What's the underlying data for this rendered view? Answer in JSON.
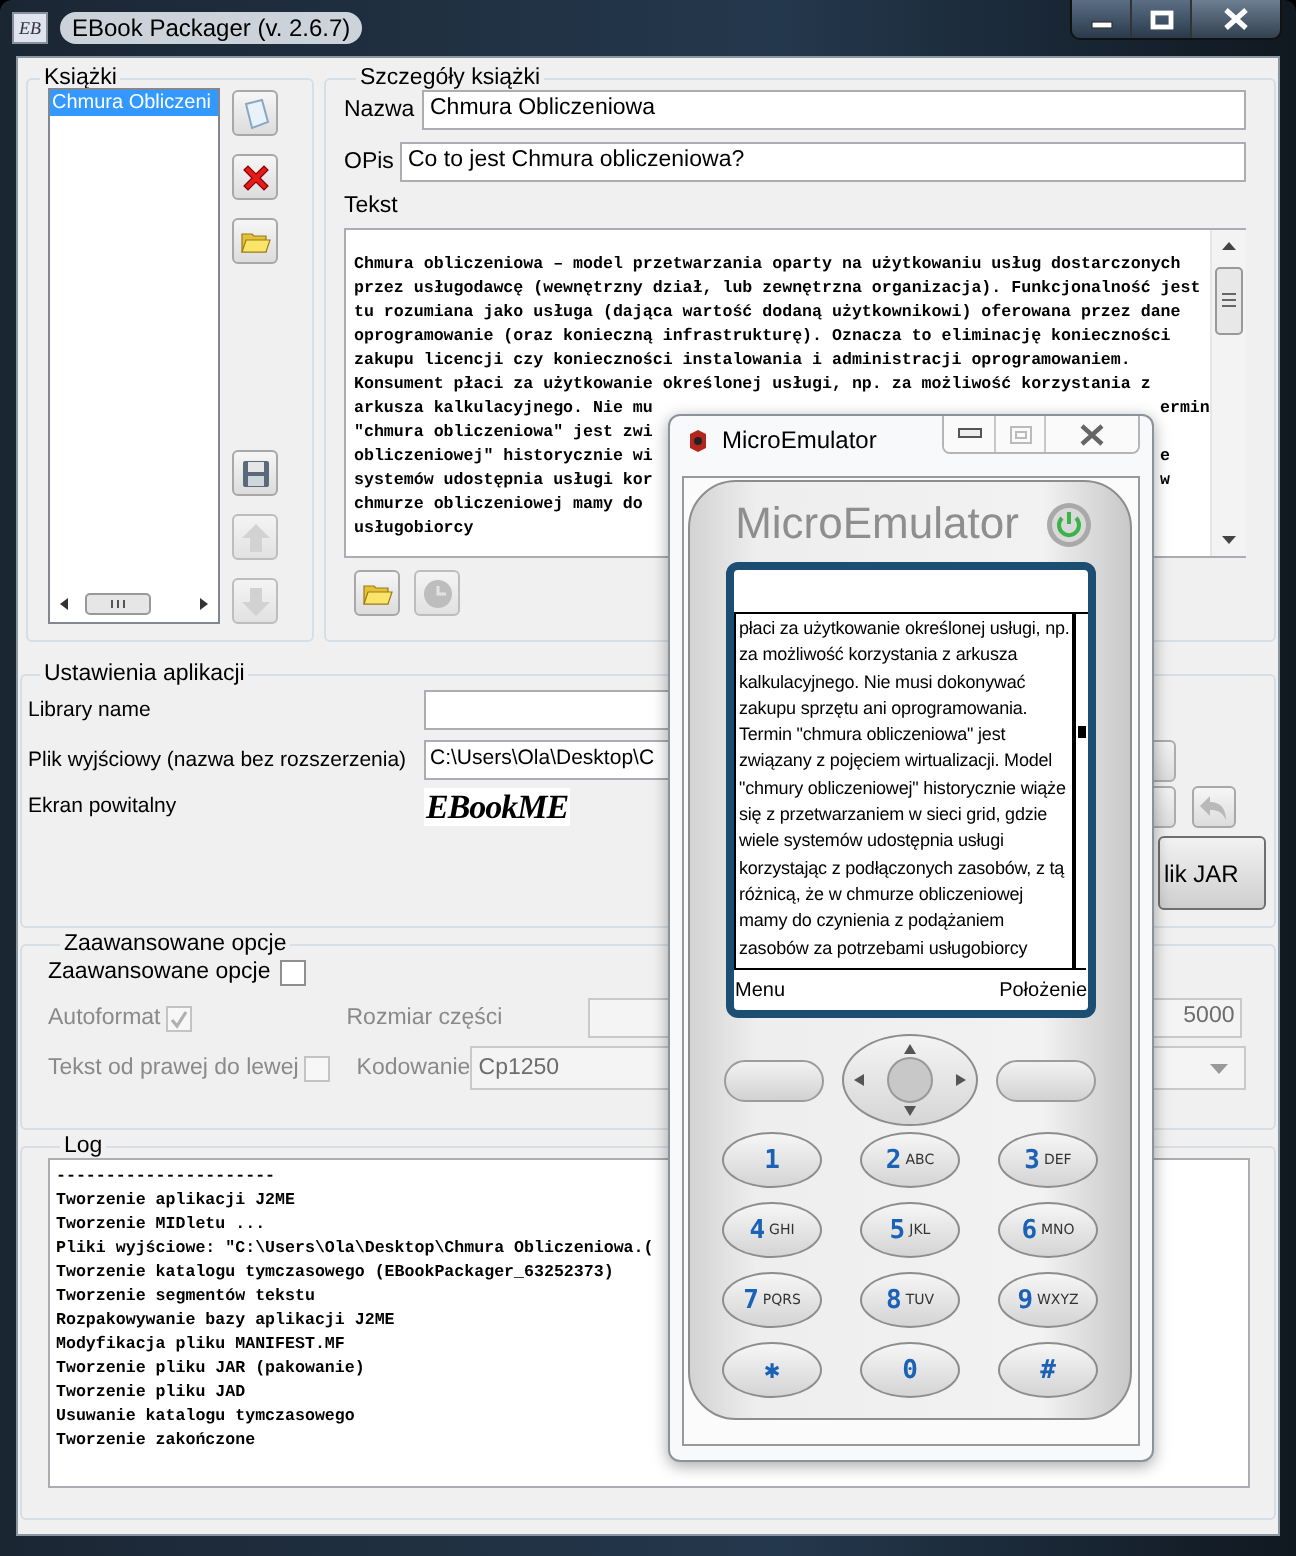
{
  "window": {
    "icon_text": "EB",
    "title": "EBook Packager (v. 2.6.7)"
  },
  "books": {
    "title": "Książki",
    "items": [
      {
        "title": "Chmura Obliczeni",
        "selected": true
      }
    ],
    "buttons": [
      {
        "kind": "new",
        "disabled": false
      },
      {
        "kind": "delete",
        "disabled": false
      },
      {
        "kind": "open",
        "disabled": false
      },
      {
        "kind": "save",
        "disabled": false
      },
      {
        "kind": "up",
        "disabled": true
      },
      {
        "kind": "down",
        "disabled": true
      }
    ]
  },
  "details": {
    "title": "Szczegóły książki",
    "name_label": "Nazwa",
    "name": "Chmura Obliczeniowa",
    "desc_label": "OPis",
    "desc": "Co to jest Chmura obliczeniowa?",
    "text_label": "Tekst",
    "text_lines": [
      {
        "text": "Chmura obliczeniowa – model przetwarzania oparty na użytkowaniu usług dostarczonych"
      },
      {
        "text": "przez usługodawcę (wewnętrzny dział, lub zewnętrzna organizacja). Funkcjonalność jest"
      },
      {
        "text": "tu rozumiana jako usługa (dająca wartość dodaną użytkownikowi) oferowana przez dane"
      },
      {
        "text": "oprogramowanie (oraz konieczną infrastrukturę). Oznacza to eliminację konieczności"
      },
      {
        "text": "zakupu licencji czy konieczności instalowania i administracji oprogramowaniem."
      },
      {
        "text": "Konsument płaci za użytkowanie określonej usługi, np. za możliwość korzystania z"
      },
      {
        "text": "arkusza kalkulacyjnego. Nie mu",
        "right": "ermin"
      },
      {
        "text": "\"chmura obliczeniowa\" jest zwi"
      },
      {
        "text": "obliczeniowej\" historycznie wi",
        "right": "e"
      },
      {
        "text": "systemów udostępnia usługi kor",
        "right": "w"
      },
      {
        "text": "chmurze obliczeniowej mamy do"
      },
      {
        "text": "usługobiorcy"
      }
    ],
    "buttons": [
      {
        "kind": "open",
        "disabled": false
      },
      {
        "kind": "clock",
        "disabled": true
      }
    ]
  },
  "app_settings": {
    "title": "Ustawienia aplikacji",
    "library_label": "Library name",
    "output_label": "Plik wyjściowy (nazwa bez rozszerzenia)",
    "output_value": "C:\\Users\\Ola\\Desktop\\C",
    "splash_label": "Ekran powitalny",
    "splash_text": "EBookME",
    "build_button": "lik JAR"
  },
  "advanced": {
    "title": "Zaawansowane opcje",
    "toggle": {
      "label": "Zaawansowane opcje",
      "checked": false
    },
    "autoformat": {
      "label": "Autoformat",
      "checked": true,
      "disabled": true
    },
    "rtl": {
      "label": "Tekst od prawej do lewej",
      "checked": false,
      "disabled": true
    },
    "part_size": {
      "label": "Rozmiar części",
      "value": "5000",
      "disabled": true
    },
    "encoding": {
      "label": "Kodowanie",
      "value": "Cp1250",
      "disabled": true
    }
  },
  "log": {
    "title": "Log",
    "lines": [
      "----------------------",
      "Tworzenie aplikacji J2ME",
      "Tworzenie MIDletu ...",
      "Pliki wyjściowe: \"C:\\Users\\Ola\\Desktop\\Chmura Obliczeniowa.(",
      "Tworzenie katalogu tymczasowego (EBookPackager_63252373)",
      "Tworzenie segmentów tekstu",
      "Rozpakowywanie bazy aplikacji J2ME",
      "Modyfikacja pliku MANIFEST.MF",
      "Tworzenie pliku JAR (pakowanie)",
      "Tworzenie pliku JAD",
      "Usuwanie katalogu tymczasowego",
      "Tworzenie zakończone"
    ]
  },
  "emulator": {
    "title": "MicroEmulator",
    "brand": "MicroEmulator",
    "screen_text": "płaci za użytkowanie określonej usługi, np. za możliwość korzystania z arkusza kalkulacyjnego. Nie musi dokonywać zakupu sprzętu ani oprogramowania. Termin \"chmura obliczeniowa\" jest związany z pojęciem wirtualizacji. Model \"chmury obliczeniowej\" historycznie wiąże się z przetwarzaniem w sieci grid, gdzie wiele systemów udostępnia usługi korzystając z podłączonych zasobów, z tą różnicą, że w chmurze obliczeniowej mamy do czynienia z podążaniem zasobów za potrzebami  usługobiorcy",
    "soft_left": "Menu",
    "soft_right": "Położenie",
    "keys": [
      {
        "digit": "1"
      },
      {
        "digit": "2",
        "letters": "ABC"
      },
      {
        "digit": "3",
        "letters": "DEF"
      },
      {
        "digit": "4",
        "letters": "GHI"
      },
      {
        "digit": "5",
        "letters": "JKL"
      },
      {
        "digit": "6",
        "letters": "MNO"
      },
      {
        "digit": "7",
        "letters": "PQRS"
      },
      {
        "digit": "8",
        "letters": "TUV"
      },
      {
        "digit": "9",
        "letters": "WXYZ"
      },
      {
        "digit": "✱"
      },
      {
        "digit": "0"
      },
      {
        "digit": "#"
      }
    ]
  }
}
